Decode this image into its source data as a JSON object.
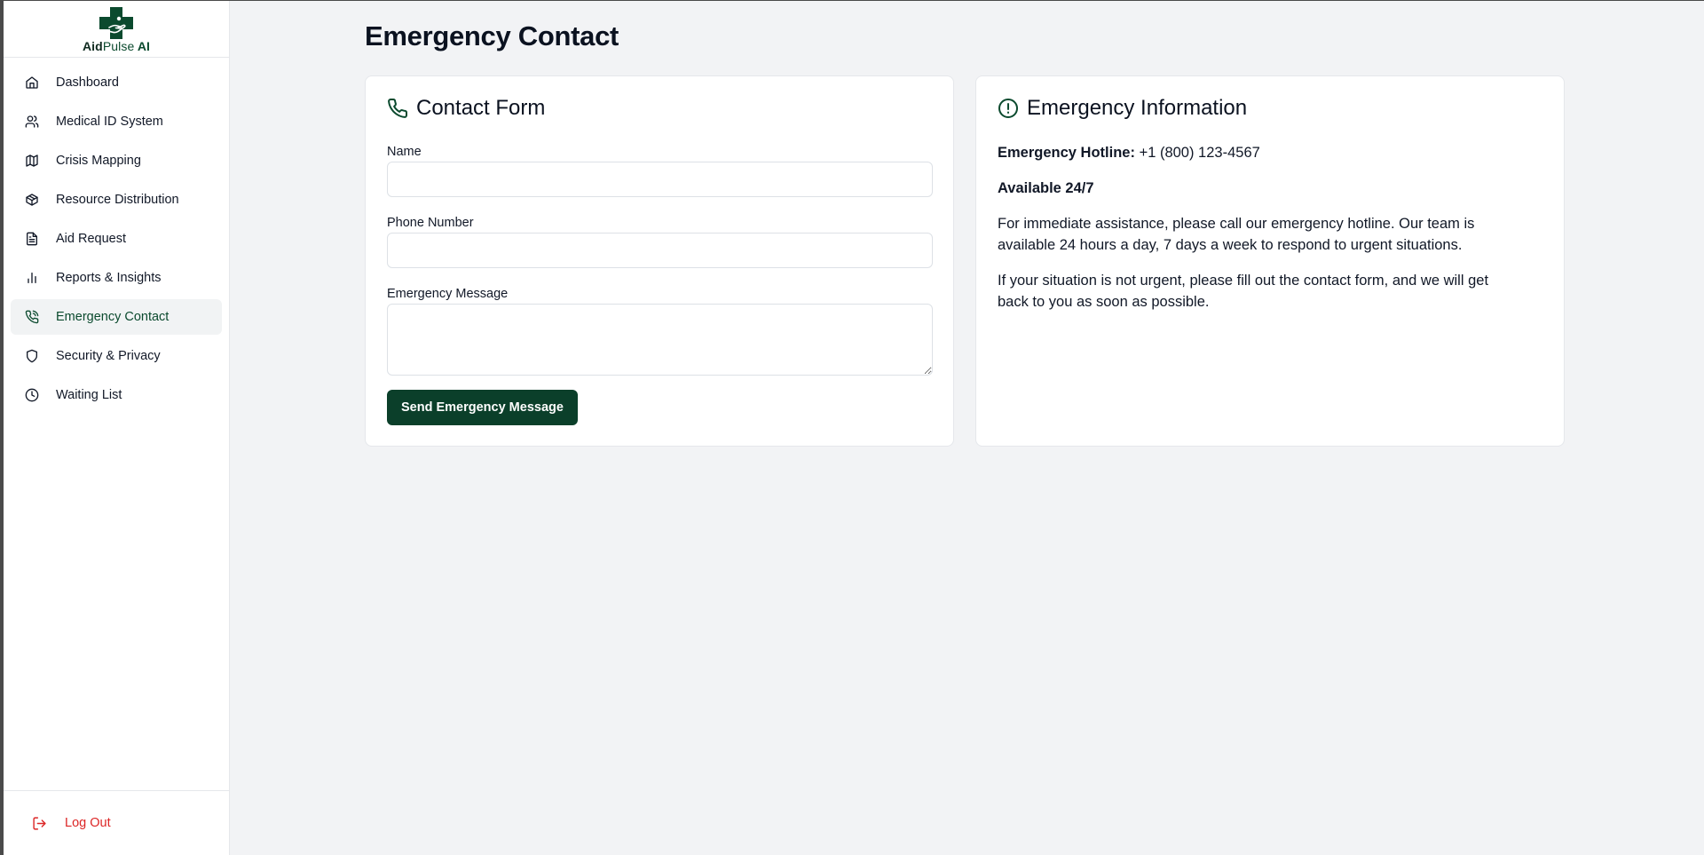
{
  "brand": {
    "part1": "Aid",
    "part2": "Pulse",
    "part3": " AI",
    "logo_icon": "medical-cross-hand-icon",
    "color": "#0b4a2e"
  },
  "sidebar": {
    "items": [
      {
        "label": "Dashboard",
        "icon": "home-icon"
      },
      {
        "label": "Medical ID System",
        "icon": "users-icon"
      },
      {
        "label": "Crisis Mapping",
        "icon": "map-icon"
      },
      {
        "label": "Resource Distribution",
        "icon": "package-icon"
      },
      {
        "label": "Aid Request",
        "icon": "file-text-icon"
      },
      {
        "label": "Reports & Insights",
        "icon": "bar-chart-icon"
      },
      {
        "label": "Emergency Contact",
        "icon": "phone-call-icon",
        "active": true
      },
      {
        "label": "Security & Privacy",
        "icon": "shield-icon"
      },
      {
        "label": "Waiting List",
        "icon": "clock-icon"
      }
    ],
    "logout_label": "Log Out"
  },
  "page": {
    "title": "Emergency Contact"
  },
  "form": {
    "title": "Contact Form",
    "name_label": "Name",
    "name_value": "",
    "phone_label": "Phone Number",
    "phone_value": "",
    "message_label": "Emergency Message",
    "message_value": "",
    "submit_label": "Send Emergency Message"
  },
  "info": {
    "title": "Emergency Information",
    "hotline_label": "Emergency Hotline:",
    "hotline_number": "+1 (800) 123-4567",
    "availability": "Available 24/7",
    "paragraph1": "For immediate assistance, please call our emergency hotline. Our team is available 24 hours a day, 7 days a week to respond to urgent situations.",
    "paragraph2": "If your situation is not urgent, please fill out the contact form, and we will get back to you as soon as possible."
  },
  "colors": {
    "accent": "#0b3f2a",
    "logout": "#dc2626",
    "background": "#f2f3f5"
  }
}
